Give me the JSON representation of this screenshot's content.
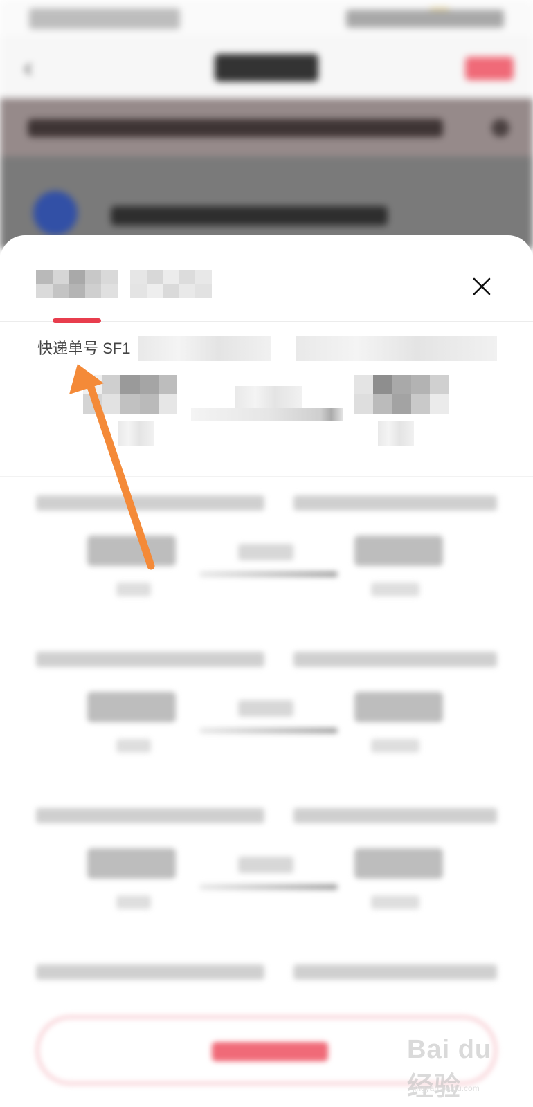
{
  "order": {
    "tracking_text": "快递单号 SF1"
  },
  "close_glyph": "×",
  "back_glyph": "‹",
  "watermark": {
    "logo": "Bai du 经验",
    "url": "jingyan.baidu.com"
  },
  "colors": {
    "accent": "#e83d4d",
    "arrow": "#f48a38",
    "notice_bg": "#968a8a"
  },
  "icons": [
    "close-icon",
    "back-icon",
    "arrow-annotation"
  ]
}
